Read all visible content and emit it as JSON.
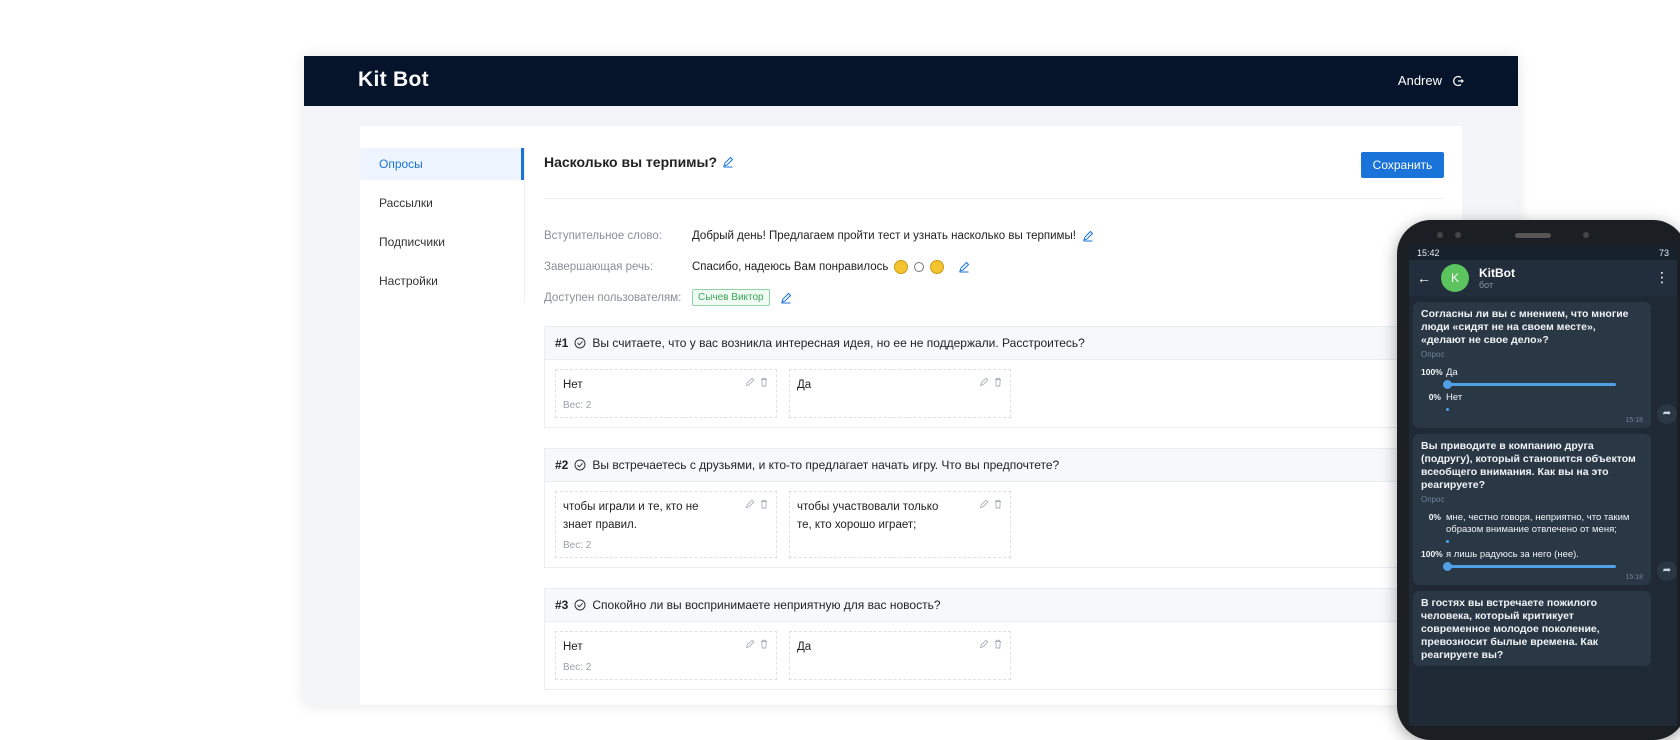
{
  "app": {
    "logo": "Kit Bot",
    "user_name": "Andrew",
    "sidebar": [
      {
        "label": "Опросы",
        "active": true
      },
      {
        "label": "Рассылки",
        "active": false
      },
      {
        "label": "Подписчики",
        "active": false
      },
      {
        "label": "Настройки",
        "active": false
      }
    ],
    "poll_title": "Насколько вы терпимы?",
    "save_label": "Сохранить",
    "meta": {
      "intro_label": "Вступительное слово:",
      "intro_value": "Добрый день! Предлагаем пройти тест и узнать насколько вы терпимы!",
      "outro_label": "Завершающая речь:",
      "outro_value": "Спасибо, надеюсь Вам понравилось",
      "access_label": "Доступен пользователям:",
      "access_tag": "Сычев Виктор"
    },
    "questions": [
      {
        "num": "#1",
        "text": "Вы считаете, что у вас возникла интересная идея, но ее не поддержали. Расстроитесь?",
        "answers": [
          {
            "text": "Нет",
            "weight": "Вес: 2"
          },
          {
            "text": "Да",
            "weight": ""
          }
        ]
      },
      {
        "num": "#2",
        "text": "Вы встречаетесь с друзьями, и кто-то предлагает начать игру. Что вы предпочтете?",
        "answers": [
          {
            "text": "чтобы играли и те, кто не знает правил.",
            "weight": "Вес: 2"
          },
          {
            "text": "чтобы участвовали только те, кто хорошо играет;",
            "weight": ""
          }
        ]
      },
      {
        "num": "#3",
        "text": "Спокойно ли вы воспринимаете неприятную для вас новость?",
        "answers": [
          {
            "text": "Нет",
            "weight": "Вес: 2"
          },
          {
            "text": "Да",
            "weight": ""
          }
        ]
      }
    ],
    "colors": {
      "topbar": "#05142b",
      "accent": "#1a73d9",
      "tag_green": "#3aa55a"
    }
  },
  "phone": {
    "status_time": "15:42",
    "status_battery": "73",
    "chat_name": "KitBot",
    "chat_sub": "бот",
    "avatar_letter": "K",
    "messages": [
      {
        "question": "Согласны ли вы с мнением, что многие люди «сидят не на своем месте», «делают не свое дело»?",
        "label": "Опрос",
        "options": [
          {
            "pct": "100%",
            "text": "Да",
            "fill": 1.0
          },
          {
            "pct": "0%",
            "text": "Нет",
            "fill": 0.0
          }
        ],
        "time": "15:18"
      },
      {
        "question": "Вы приводите в компанию друга (подругу), который становится объектом всеобщего внимания. Как вы на это реагируете?",
        "label": "Опрос",
        "options": [
          {
            "pct": "0%",
            "text": "мне, честно говоря, неприятно, что таким образом внимание отвлечено от меня;",
            "fill": 0.0
          },
          {
            "pct": "100%",
            "text": "я лишь радуюсь за него (нее).",
            "fill": 1.0
          }
        ],
        "time": "15:18"
      },
      {
        "question": "В гостях вы встречаете пожилого человека, который критикует современное молодое поколение, превозносит былые времена. Как реагируете вы?",
        "label": "",
        "options": [],
        "time": ""
      }
    ]
  }
}
